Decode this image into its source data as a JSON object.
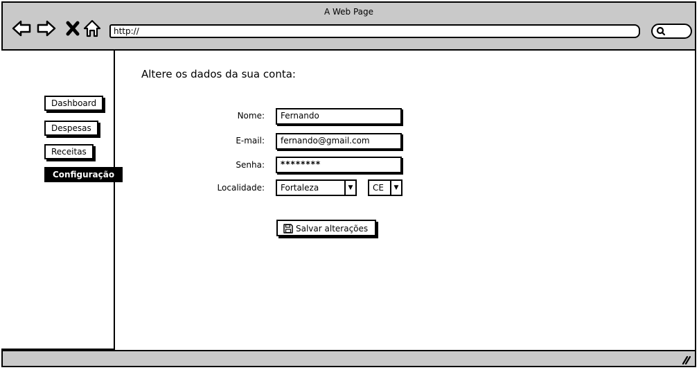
{
  "window": {
    "title": "A Web Page"
  },
  "browser": {
    "url": "http://"
  },
  "sidebar": {
    "items": [
      {
        "label": "Dashboard"
      },
      {
        "label": "Despesas"
      },
      {
        "label": "Receitas"
      },
      {
        "label": "Configuração"
      }
    ]
  },
  "main": {
    "heading": "Altere os dados da sua conta:",
    "form": {
      "name_label": "Nome:",
      "name_value": "Fernando",
      "email_label": "E-mail:",
      "email_value": "fernando@gmail.com",
      "password_label": "Senha:",
      "password_value": "********",
      "location_label": "Localidade:",
      "city_value": "Fortaleza",
      "state_value": "CE"
    },
    "save_label": "Salvar alterações"
  },
  "icons": {
    "back": "arrow-left-icon",
    "forward": "arrow-right-icon",
    "stop": "close-icon",
    "home": "home-icon",
    "search": "search-icon",
    "save": "floppy-disk-icon",
    "dropdown": "chevron-down-icon",
    "resize": "resize-grip-icon"
  }
}
